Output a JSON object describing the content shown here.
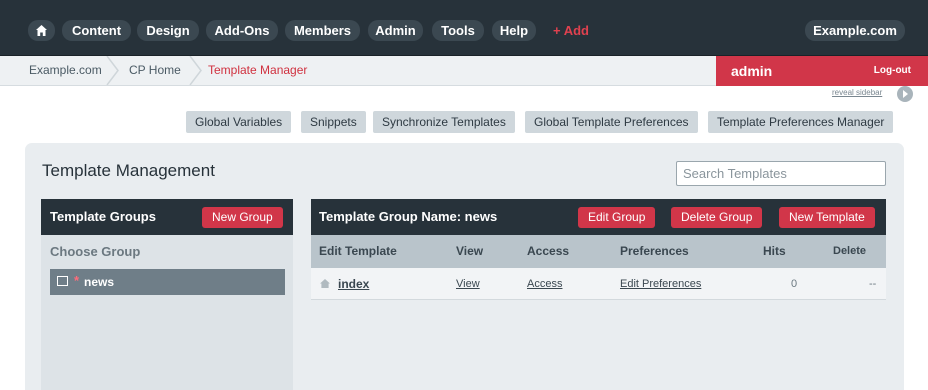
{
  "nav": {
    "items": [
      "Content",
      "Design",
      "Add-Ons",
      "Members",
      "Admin",
      "Tools",
      "Help"
    ],
    "add_label": "+ Add",
    "site_label": "Example.com"
  },
  "breadcrumb": {
    "items": [
      "Example.com",
      "CP Home"
    ],
    "current": "Template Manager"
  },
  "user": {
    "name": "admin",
    "logout_label": "Log-out"
  },
  "reveal_sidebar_label": "reveal sidebar",
  "subnav": {
    "items": [
      "Global Variables",
      "Snippets",
      "Synchronize Templates",
      "Global Template Preferences",
      "Template Preferences Manager"
    ]
  },
  "page": {
    "title": "Template Management",
    "search_placeholder": "Search Templates"
  },
  "groups": {
    "title": "Template Groups",
    "new_group_label": "New Group",
    "choose_label": "Choose Group",
    "items": [
      {
        "star": "*",
        "name": "news"
      }
    ]
  },
  "group_detail": {
    "title": "Template Group Name: news",
    "edit_group_label": "Edit Group",
    "delete_group_label": "Delete Group",
    "new_template_label": "New Template",
    "columns": [
      "Edit Template",
      "View",
      "Access",
      "Preferences",
      "Hits",
      "Delete"
    ],
    "rows": [
      {
        "name": "index",
        "view": "View",
        "access": "Access",
        "preferences": "Edit Preferences",
        "hits": "0",
        "delete": "--"
      }
    ]
  },
  "colors": {
    "nav_bg": "#27323a",
    "accent_red": "#d13649",
    "panel_bg": "#e9edf0"
  }
}
